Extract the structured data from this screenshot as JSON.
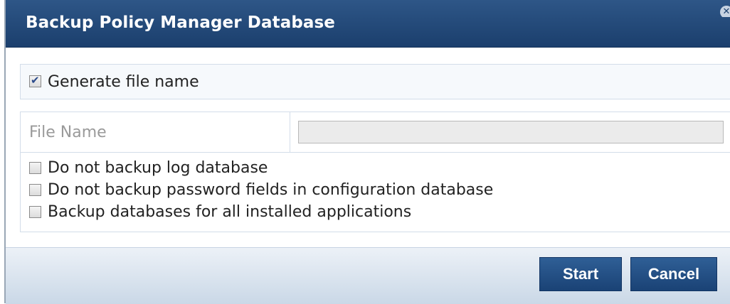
{
  "dialog": {
    "title": "Backup Policy Manager Database",
    "close_icon": "close-icon",
    "generate_file_name": {
      "label": "Generate file name",
      "checked": true
    },
    "file_name": {
      "label": "File Name",
      "value": "",
      "disabled": true
    },
    "options": [
      {
        "label": "Do not backup log database",
        "checked": false
      },
      {
        "label": "Do not backup password fields in configuration database",
        "checked": false
      },
      {
        "label": "Backup databases for all installed applications",
        "checked": false
      }
    ],
    "buttons": {
      "start": "Start",
      "cancel": "Cancel"
    }
  },
  "colors": {
    "titlebar": "#1b3f6d",
    "button": "#1f4a7d",
    "footer": "#cad8e7",
    "section_border": "#d3dde9"
  }
}
